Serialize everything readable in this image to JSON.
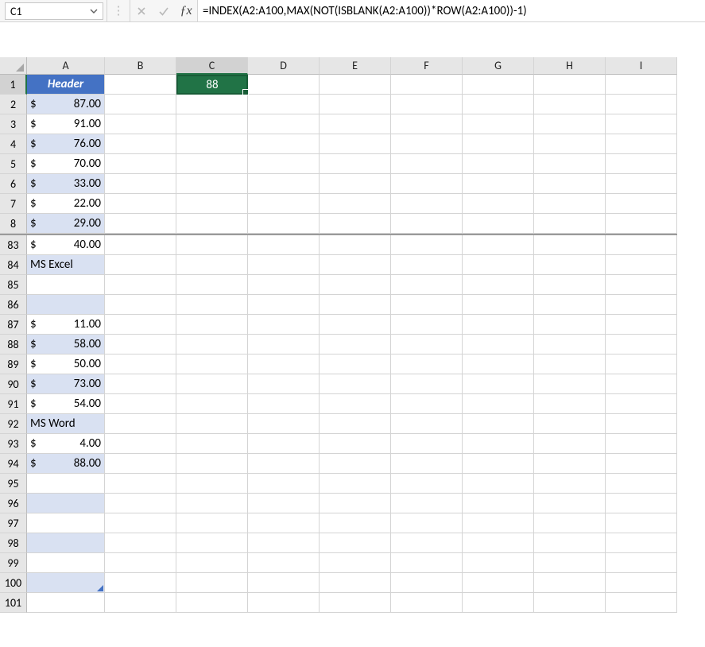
{
  "name_box": {
    "value": "C1"
  },
  "formula": "=INDEX(A2:A100,MAX(NOT(ISBLANK(A2:A100))*ROW(A2:A100))-1)",
  "columns": [
    "A",
    "B",
    "C",
    "D",
    "E",
    "F",
    "G",
    "H",
    "I"
  ],
  "selected_cell": {
    "col": "C",
    "row": 1,
    "display": "88"
  },
  "header_label": "Header",
  "rows_top": [
    {
      "row": 1,
      "type": "header"
    },
    {
      "row": 2,
      "type": "money",
      "value": "87.00"
    },
    {
      "row": 3,
      "type": "money",
      "value": "91.00"
    },
    {
      "row": 4,
      "type": "money",
      "value": "76.00"
    },
    {
      "row": 5,
      "type": "money",
      "value": "70.00"
    },
    {
      "row": 6,
      "type": "money",
      "value": "33.00"
    },
    {
      "row": 7,
      "type": "money",
      "value": "22.00"
    },
    {
      "row": 8,
      "type": "money",
      "value": "29.00"
    }
  ],
  "rows_bottom": [
    {
      "row": 83,
      "type": "money",
      "value": "40.00"
    },
    {
      "row": 84,
      "type": "text",
      "value": "MS Excel"
    },
    {
      "row": 85,
      "type": "empty"
    },
    {
      "row": 86,
      "type": "empty"
    },
    {
      "row": 87,
      "type": "money",
      "value": "11.00"
    },
    {
      "row": 88,
      "type": "money",
      "value": "58.00"
    },
    {
      "row": 89,
      "type": "money",
      "value": "50.00"
    },
    {
      "row": 90,
      "type": "money",
      "value": "73.00"
    },
    {
      "row": 91,
      "type": "money",
      "value": "54.00"
    },
    {
      "row": 92,
      "type": "text",
      "value": "MS Word"
    },
    {
      "row": 93,
      "type": "money",
      "value": "4.00"
    },
    {
      "row": 94,
      "type": "money",
      "value": "88.00"
    },
    {
      "row": 95,
      "type": "empty"
    },
    {
      "row": 96,
      "type": "empty"
    },
    {
      "row": 97,
      "type": "empty"
    },
    {
      "row": 98,
      "type": "empty"
    },
    {
      "row": 99,
      "type": "empty"
    },
    {
      "row": 100,
      "type": "empty",
      "marker": true
    },
    {
      "row": 101,
      "type": "blank"
    }
  ],
  "alt_fill_rows": [
    2,
    4,
    6,
    8,
    84,
    86,
    88,
    90,
    92,
    94,
    96,
    98,
    100
  ]
}
